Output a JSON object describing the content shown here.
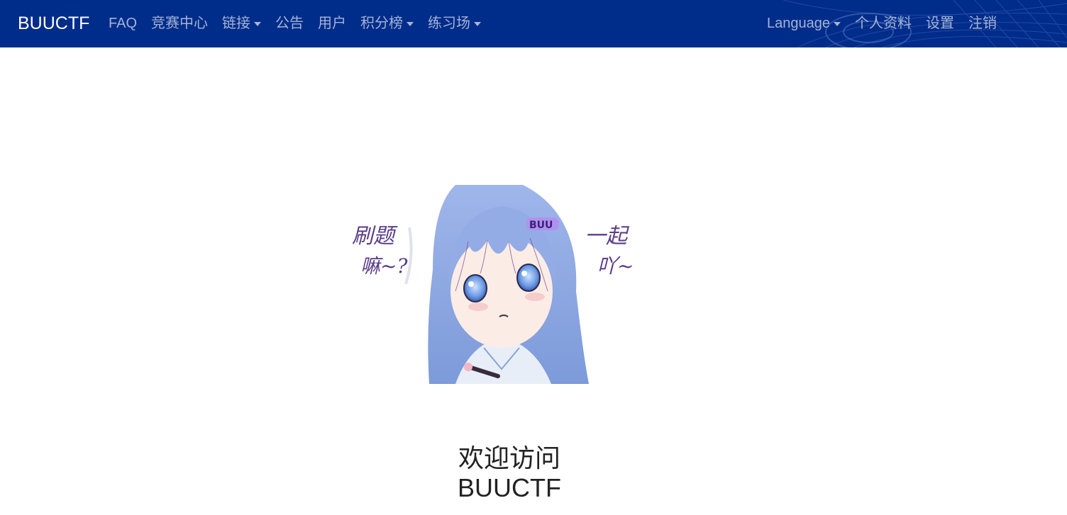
{
  "navbar": {
    "brand": "BUUCTF",
    "left_items": [
      {
        "label": "FAQ",
        "dropdown": false
      },
      {
        "label": "竞赛中心",
        "dropdown": false
      },
      {
        "label": "链接",
        "dropdown": true
      },
      {
        "label": "公告",
        "dropdown": false
      },
      {
        "label": "用户",
        "dropdown": false
      },
      {
        "label": "积分榜",
        "dropdown": true
      },
      {
        "label": "练习场",
        "dropdown": true
      }
    ],
    "right_items": [
      {
        "label": "Language",
        "dropdown": true
      },
      {
        "label": "个人资料",
        "dropdown": false
      },
      {
        "label": "设置",
        "dropdown": false
      },
      {
        "label": "注销",
        "dropdown": false
      }
    ],
    "colors": {
      "background": "#002c8a",
      "link": "#a5b3d6",
      "brand": "#ffffff"
    }
  },
  "hero": {
    "image": "anime-girl-illustration",
    "caption_left_line1": "刷题",
    "caption_left_line2": "嘛~?",
    "caption_right_line1": "一起",
    "caption_right_line2": "吖~",
    "hairclip_text": "BUU"
  },
  "welcome": {
    "line1": "欢迎访问",
    "line2": "BUUCTF"
  }
}
